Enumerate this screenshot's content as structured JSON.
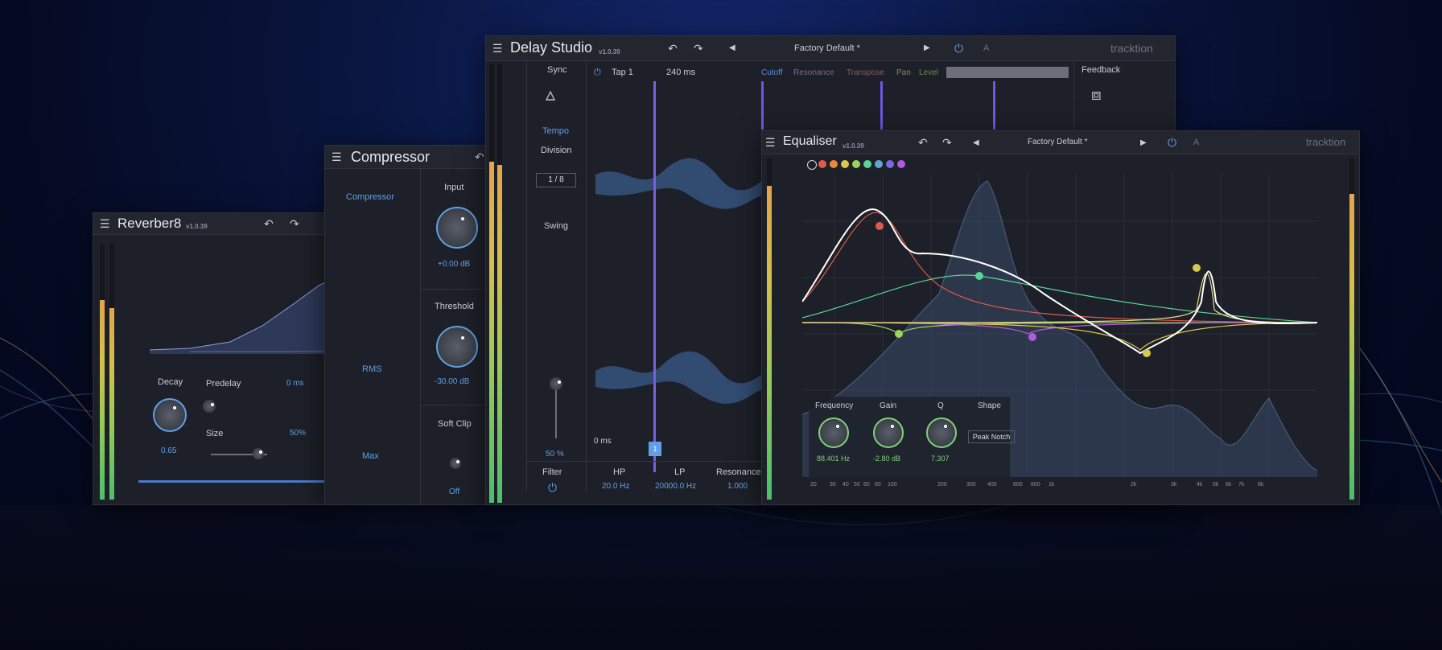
{
  "colors": {
    "accent_blue": "#5fa0e6",
    "meter_green": "#4bbf6b",
    "meter_yellow": "#d4c04a",
    "tap_purple": "#7a5fe0",
    "panel_bg": "#1d2028"
  },
  "reverb": {
    "title": "Reverber8",
    "version": "v1.0.39",
    "decay_label": "Decay",
    "decay_value": "0.65",
    "predelay_label": "Predelay",
    "predelay_value": "0 ms",
    "size_label": "Size",
    "size_value": "50%"
  },
  "compressor": {
    "title": "Compressor",
    "mode_label": "Compressor",
    "rms_label": "RMS",
    "max_label": "Max",
    "input_label": "Input",
    "input_value": "+0.00 dB",
    "threshold_label": "Threshold",
    "threshold_value": "-30.00 dB",
    "softclip_label": "Soft Clip",
    "softclip_value": "Off"
  },
  "delay": {
    "title": "Delay Studio",
    "version": "v1.0.39",
    "preset": "Factory Default *",
    "ab_label": "A",
    "brand": "tracktion",
    "sync_label": "Sync",
    "tempo_label": "Tempo",
    "division_label": "Division",
    "division_value": "1 / 8",
    "swing_label": "Swing",
    "swing_value": "50 %",
    "tap_label": "Tap 1",
    "tap_time": "240 ms",
    "time_start": "0 ms",
    "tap_marker": "1",
    "params": [
      "Cutoff",
      "Resonance",
      "Transpose",
      "Pan",
      "Level"
    ],
    "feedback_label": "Feedback",
    "filter_label": "Filter",
    "hp_label": "HP",
    "hp_value": "20.0 Hz",
    "lp_label": "LP",
    "lp_value": "20000.0 Hz",
    "resonance_label": "Resonance",
    "resonance_value": "1.000"
  },
  "eq": {
    "title": "Equaliser",
    "version": "v1.0.39",
    "preset": "Factory Default *",
    "ab_label": "A",
    "brand": "tracktion",
    "band_colors": [
      "#d8d8d8",
      "#e05a4a",
      "#e88a3a",
      "#d9c84a",
      "#9ad45a",
      "#5ad49a",
      "#5aa8d4",
      "#7a6ae0",
      "#b35ae0"
    ],
    "frequency_label": "Frequency",
    "frequency_value": "88.401 Hz",
    "gain_label": "Gain",
    "gain_value": "-2.80 dB",
    "q_label": "Q",
    "q_value": "7.307",
    "shape_label": "Shape",
    "shape_value": "Peak Notch",
    "freq_ticks": [
      "20",
      "30",
      "40",
      "50",
      "60",
      "80",
      "100",
      "200",
      "300",
      "400",
      "600",
      "800",
      "1k",
      "2k",
      "3k",
      "4k",
      "5k",
      "6k",
      "7k",
      "8k"
    ]
  }
}
